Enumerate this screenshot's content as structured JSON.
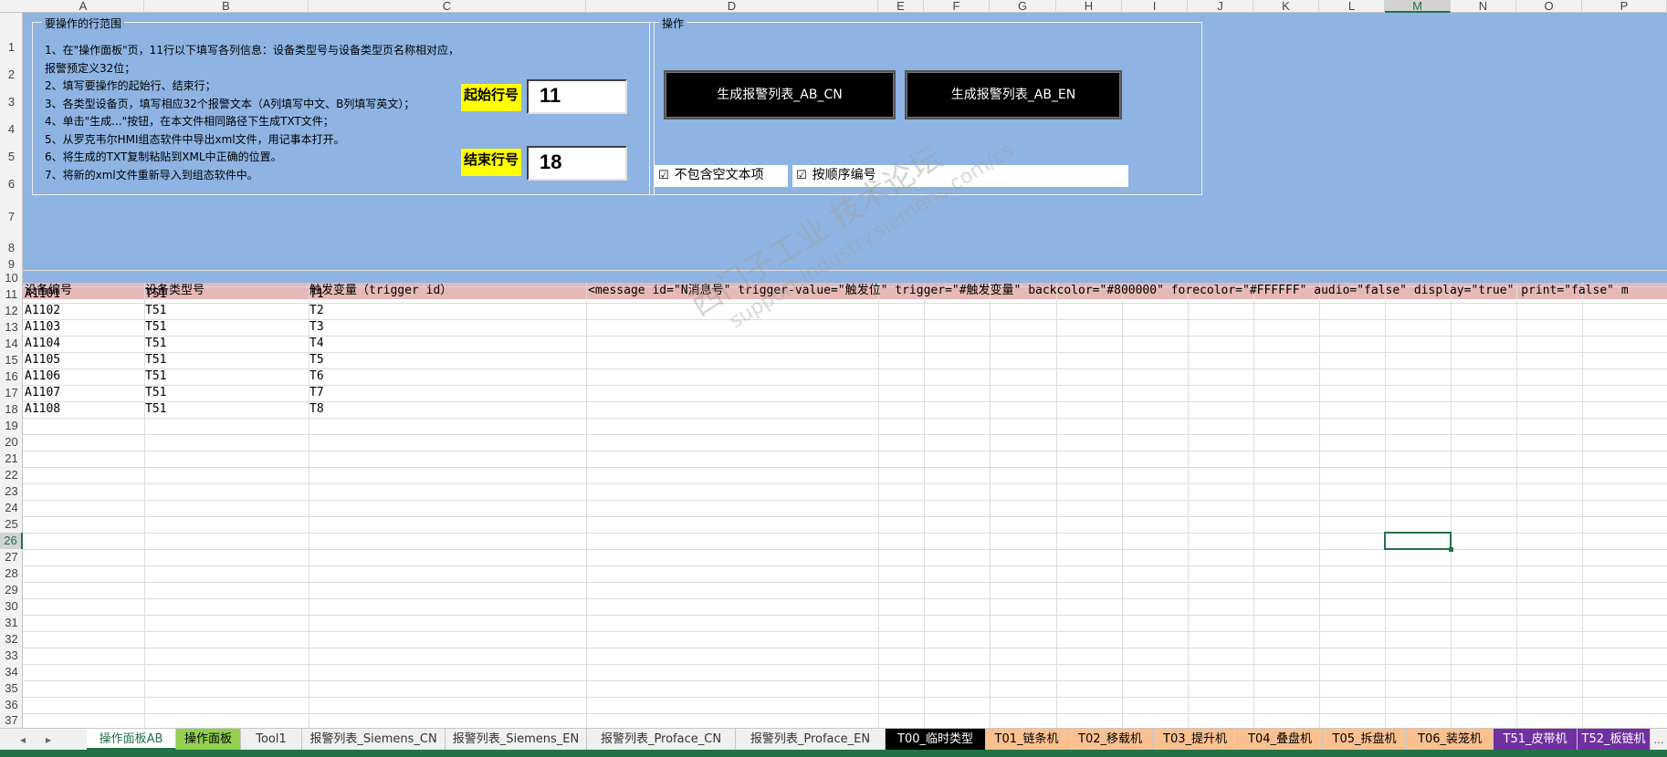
{
  "columns": [
    "A",
    "B",
    "C",
    "D",
    "E",
    "F",
    "G",
    "H",
    "I",
    "J",
    "K",
    "L",
    "M",
    "N",
    "O",
    "P"
  ],
  "selected_column": "M",
  "rows": [
    "1",
    "2",
    "3",
    "4",
    "5",
    "6",
    "7",
    "8",
    "9",
    "10",
    "11",
    "12",
    "13",
    "14",
    "15",
    "16",
    "17",
    "18",
    "19",
    "20",
    "21",
    "22",
    "23",
    "24",
    "25",
    "26",
    "27",
    "28",
    "29",
    "30",
    "31",
    "32",
    "33",
    "34",
    "35",
    "36",
    "37"
  ],
  "selected_row": "26",
  "panel_left": {
    "title": "要操作的行范围",
    "instructions": [
      "1、在\"操作面板\"页，11行以下填写各列信息：设备类型号与设备类型页名称相对应，",
      "报警预定义32位；",
      "2、填写要操作的起始行、结束行；",
      "3、各类型设备页，填写相应32个报警文本（A列填写中文、B列填写英文）；",
      "4、单击\"生成...\"按钮，在本文件相同路径下生成TXT文件；",
      "5、从罗克韦尔HMI组态软件中导出xml文件，用记事本打开。",
      "6、将生成的TXT复制粘贴到XML中正确的位置。",
      "7、将新的xml文件重新导入到组态软件中。"
    ],
    "start_row_label": "起始行号",
    "start_row_value": "11",
    "end_row_label": "结束行号",
    "end_row_value": "18"
  },
  "panel_right": {
    "title": "操作",
    "button_cn": "生成报警列表_AB_CN",
    "button_en": "生成报警列表_AB_EN",
    "checkbox_1_mark": "☑",
    "checkbox_1": "不包含空文本项",
    "checkbox_2_mark": "☑",
    "checkbox_2": "按顺序编号"
  },
  "header_row": {
    "a": "设备编号",
    "b": "设备类型号",
    "c": "触发变量（trigger id）",
    "d": "<message id=\"N消息号\" trigger-value=\"触发位\" trigger=\"#触发变量\" backcolor=\"#800000\" forecolor=\"#FFFFFF\" audio=\"false\" display=\"true\" print=\"false\" m"
  },
  "data_rows": [
    {
      "a": "A1101",
      "b": "T51",
      "c": "T1"
    },
    {
      "a": "A1102",
      "b": "T51",
      "c": "T2"
    },
    {
      "a": "A1103",
      "b": "T51",
      "c": "T3"
    },
    {
      "a": "A1104",
      "b": "T51",
      "c": "T4"
    },
    {
      "a": "A1105",
      "b": "T51",
      "c": "T5"
    },
    {
      "a": "A1106",
      "b": "T51",
      "c": "T6"
    },
    {
      "a": "A1107",
      "b": "T51",
      "c": "T7"
    },
    {
      "a": "A1108",
      "b": "T51",
      "c": "T8"
    }
  ],
  "watermark": {
    "line1": "西门子工业 技术论坛",
    "line2": "support.industry.siemens.com/cs"
  },
  "nav": {
    "prev": "◂",
    "next": "▸"
  },
  "sheet_tabs": [
    {
      "label": "操作面板AB",
      "color": "#ffffff",
      "text": "#217346"
    },
    {
      "label": "操作面板",
      "color": "#92d050",
      "text": "#000000"
    },
    {
      "label": "Tool1",
      "color": "#f0f0f0",
      "text": "#333333"
    },
    {
      "label": "报警列表_Siemens_CN",
      "color": "#f0f0f0",
      "text": "#333333"
    },
    {
      "label": "报警列表_Siemens_EN",
      "color": "#f0f0f0",
      "text": "#333333"
    },
    {
      "label": "报警列表_Proface_CN",
      "color": "#f0f0f0",
      "text": "#333333"
    },
    {
      "label": "报警列表_Proface_EN",
      "color": "#f0f0f0",
      "text": "#333333"
    },
    {
      "label": "T00_临时类型",
      "color": "#000000",
      "text": "#ffffff"
    },
    {
      "label": "T01_链条机",
      "color": "#fac090",
      "text": "#000000"
    },
    {
      "label": "T02_移载机",
      "color": "#fac090",
      "text": "#000000"
    },
    {
      "label": "T03_提升机",
      "color": "#fac090",
      "text": "#000000"
    },
    {
      "label": "T04_叠盘机",
      "color": "#fac090",
      "text": "#000000"
    },
    {
      "label": "T05_拆盘机",
      "color": "#fac090",
      "text": "#000000"
    },
    {
      "label": "T06_装笼机",
      "color": "#fac090",
      "text": "#000000"
    },
    {
      "label": "T51_皮带机",
      "color": "#7030a0",
      "text": "#ffffff"
    },
    {
      "label": "T52_板链机",
      "color": "#7030a0",
      "text": "#ffffff"
    }
  ],
  "tabs_more": "...",
  "colors": {
    "accent": "#217346",
    "blue_area": "#8db4e2",
    "header_row": "#e6b8b7",
    "label_yellow": "#ffff00"
  }
}
